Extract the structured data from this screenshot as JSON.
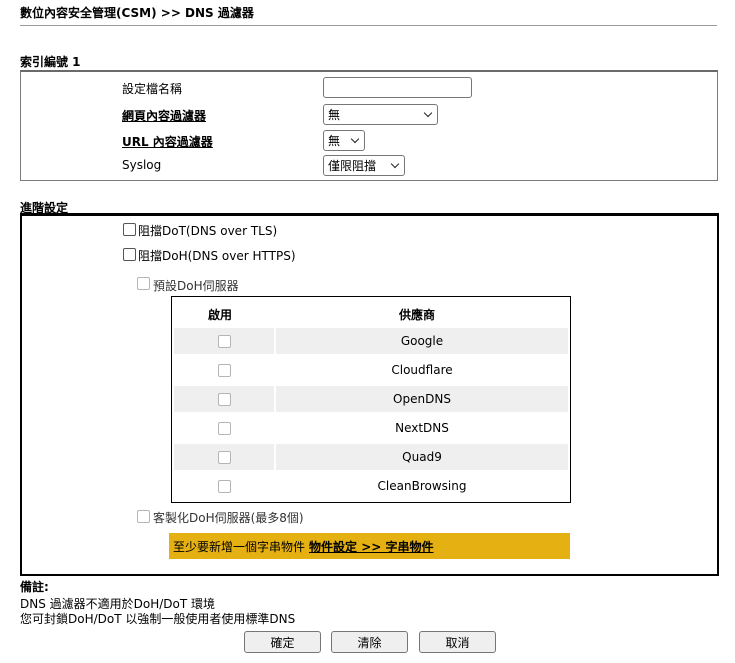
{
  "page": {
    "title": "數位內容安全管理(CSM) >> DNS 過濾器"
  },
  "profile_section": {
    "title": "索引編號 1",
    "name_label": "設定檔名稱",
    "name_value": "",
    "web_filter_label": "網頁內容過濾器",
    "web_filter_value": "無",
    "url_filter_label": "URL 內容過濾器",
    "url_filter_value": "無",
    "syslog_label": "Syslog",
    "syslog_value": "僅限阻擋"
  },
  "advanced_section": {
    "title": "進階設定",
    "block_dot_label": "阻擋DoT(DNS over TLS)",
    "block_dot_checked": false,
    "block_doh_label": "阻擋DoH(DNS over HTTPS)",
    "block_doh_checked": false,
    "preset_doh_label": "預設DoH伺服器",
    "preset_doh_checked": false,
    "table": {
      "headers": {
        "enable": "啟用",
        "provider": "供應商"
      },
      "rows": [
        {
          "provider": "Google",
          "enabled": false
        },
        {
          "provider": "Cloudflare",
          "enabled": false
        },
        {
          "provider": "OpenDNS",
          "enabled": false
        },
        {
          "provider": "NextDNS",
          "enabled": false
        },
        {
          "provider": "Quad9",
          "enabled": false
        },
        {
          "provider": "CleanBrowsing",
          "enabled": false
        }
      ]
    },
    "custom_doh_label": "客製化DoH伺服器(最多8個)",
    "custom_doh_checked": false,
    "banner": {
      "text": "至少要新增一個字串物件",
      "link": "物件設定 >> 字串物件",
      "color": "#e5b012"
    }
  },
  "notes": {
    "title": "備註:",
    "line1": "DNS 過濾器不適用於DoH/DoT 環境",
    "line2": "您可封鎖DoH/DoT 以強制一般使用者使用標準DNS"
  },
  "buttons": {
    "ok": "確定",
    "clear": "清除",
    "cancel": "取消"
  }
}
